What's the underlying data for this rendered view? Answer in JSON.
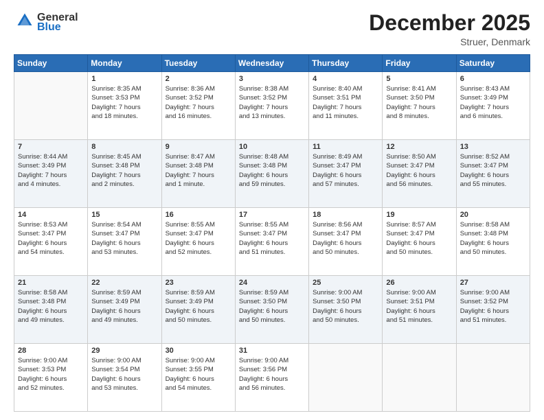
{
  "header": {
    "logo_line1": "General",
    "logo_line2": "Blue",
    "month": "December 2025",
    "location": "Struer, Denmark"
  },
  "weekdays": [
    "Sunday",
    "Monday",
    "Tuesday",
    "Wednesday",
    "Thursday",
    "Friday",
    "Saturday"
  ],
  "weeks": [
    [
      {
        "day": "",
        "info": ""
      },
      {
        "day": "1",
        "info": "Sunrise: 8:35 AM\nSunset: 3:53 PM\nDaylight: 7 hours\nand 18 minutes."
      },
      {
        "day": "2",
        "info": "Sunrise: 8:36 AM\nSunset: 3:52 PM\nDaylight: 7 hours\nand 16 minutes."
      },
      {
        "day": "3",
        "info": "Sunrise: 8:38 AM\nSunset: 3:52 PM\nDaylight: 7 hours\nand 13 minutes."
      },
      {
        "day": "4",
        "info": "Sunrise: 8:40 AM\nSunset: 3:51 PM\nDaylight: 7 hours\nand 11 minutes."
      },
      {
        "day": "5",
        "info": "Sunrise: 8:41 AM\nSunset: 3:50 PM\nDaylight: 7 hours\nand 8 minutes."
      },
      {
        "day": "6",
        "info": "Sunrise: 8:43 AM\nSunset: 3:49 PM\nDaylight: 7 hours\nand 6 minutes."
      }
    ],
    [
      {
        "day": "7",
        "info": "Sunrise: 8:44 AM\nSunset: 3:49 PM\nDaylight: 7 hours\nand 4 minutes."
      },
      {
        "day": "8",
        "info": "Sunrise: 8:45 AM\nSunset: 3:48 PM\nDaylight: 7 hours\nand 2 minutes."
      },
      {
        "day": "9",
        "info": "Sunrise: 8:47 AM\nSunset: 3:48 PM\nDaylight: 7 hours\nand 1 minute."
      },
      {
        "day": "10",
        "info": "Sunrise: 8:48 AM\nSunset: 3:48 PM\nDaylight: 6 hours\nand 59 minutes."
      },
      {
        "day": "11",
        "info": "Sunrise: 8:49 AM\nSunset: 3:47 PM\nDaylight: 6 hours\nand 57 minutes."
      },
      {
        "day": "12",
        "info": "Sunrise: 8:50 AM\nSunset: 3:47 PM\nDaylight: 6 hours\nand 56 minutes."
      },
      {
        "day": "13",
        "info": "Sunrise: 8:52 AM\nSunset: 3:47 PM\nDaylight: 6 hours\nand 55 minutes."
      }
    ],
    [
      {
        "day": "14",
        "info": "Sunrise: 8:53 AM\nSunset: 3:47 PM\nDaylight: 6 hours\nand 54 minutes."
      },
      {
        "day": "15",
        "info": "Sunrise: 8:54 AM\nSunset: 3:47 PM\nDaylight: 6 hours\nand 53 minutes."
      },
      {
        "day": "16",
        "info": "Sunrise: 8:55 AM\nSunset: 3:47 PM\nDaylight: 6 hours\nand 52 minutes."
      },
      {
        "day": "17",
        "info": "Sunrise: 8:55 AM\nSunset: 3:47 PM\nDaylight: 6 hours\nand 51 minutes."
      },
      {
        "day": "18",
        "info": "Sunrise: 8:56 AM\nSunset: 3:47 PM\nDaylight: 6 hours\nand 50 minutes."
      },
      {
        "day": "19",
        "info": "Sunrise: 8:57 AM\nSunset: 3:47 PM\nDaylight: 6 hours\nand 50 minutes."
      },
      {
        "day": "20",
        "info": "Sunrise: 8:58 AM\nSunset: 3:48 PM\nDaylight: 6 hours\nand 50 minutes."
      }
    ],
    [
      {
        "day": "21",
        "info": "Sunrise: 8:58 AM\nSunset: 3:48 PM\nDaylight: 6 hours\nand 49 minutes."
      },
      {
        "day": "22",
        "info": "Sunrise: 8:59 AM\nSunset: 3:49 PM\nDaylight: 6 hours\nand 49 minutes."
      },
      {
        "day": "23",
        "info": "Sunrise: 8:59 AM\nSunset: 3:49 PM\nDaylight: 6 hours\nand 50 minutes."
      },
      {
        "day": "24",
        "info": "Sunrise: 8:59 AM\nSunset: 3:50 PM\nDaylight: 6 hours\nand 50 minutes."
      },
      {
        "day": "25",
        "info": "Sunrise: 9:00 AM\nSunset: 3:50 PM\nDaylight: 6 hours\nand 50 minutes."
      },
      {
        "day": "26",
        "info": "Sunrise: 9:00 AM\nSunset: 3:51 PM\nDaylight: 6 hours\nand 51 minutes."
      },
      {
        "day": "27",
        "info": "Sunrise: 9:00 AM\nSunset: 3:52 PM\nDaylight: 6 hours\nand 51 minutes."
      }
    ],
    [
      {
        "day": "28",
        "info": "Sunrise: 9:00 AM\nSunset: 3:53 PM\nDaylight: 6 hours\nand 52 minutes."
      },
      {
        "day": "29",
        "info": "Sunrise: 9:00 AM\nSunset: 3:54 PM\nDaylight: 6 hours\nand 53 minutes."
      },
      {
        "day": "30",
        "info": "Sunrise: 9:00 AM\nSunset: 3:55 PM\nDaylight: 6 hours\nand 54 minutes."
      },
      {
        "day": "31",
        "info": "Sunrise: 9:00 AM\nSunset: 3:56 PM\nDaylight: 6 hours\nand 56 minutes."
      },
      {
        "day": "",
        "info": ""
      },
      {
        "day": "",
        "info": ""
      },
      {
        "day": "",
        "info": ""
      }
    ]
  ]
}
